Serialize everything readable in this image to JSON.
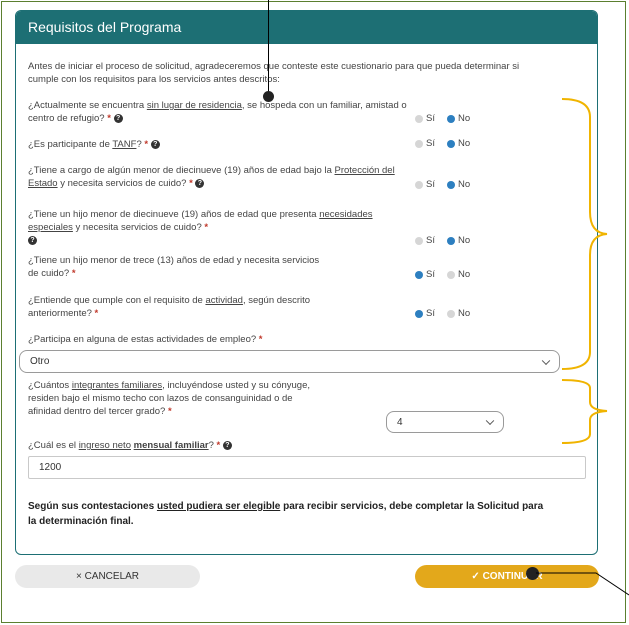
{
  "panel": {
    "title": "Requisitos del Programa"
  },
  "intro": "Antes de iniciar el proceso de solicitud, agradeceremos que conteste este cuestionario para que pueda determinar si cumple con los requisitos para los servicios antes descritos:",
  "radio_labels": {
    "yes": "Sí",
    "no": "No"
  },
  "questions": [
    {
      "pre": "¿Actualmente se encuentra ",
      "link": "sin lugar de residencia",
      "post": ", se hospeda con un familiar, amistad o centro de refugio?",
      "answer": "No"
    },
    {
      "pre": "¿Es participante de ",
      "link": "TANF",
      "post": "?",
      "answer": "No"
    },
    {
      "pre": "¿Tiene a cargo de algún menor de diecinueve (19) años de edad bajo la ",
      "link": "Protección del Estado",
      "post": " y necesita servicios de cuido?",
      "answer": "No"
    },
    {
      "pre": "¿Tiene un hijo menor de diecinueve (19) años de edad que presenta ",
      "link": "necesidades especiales",
      "post": " y necesita servicios de cuido?",
      "answer": "No"
    },
    {
      "pre": "¿Tiene un hijo menor de trece (13) años de edad y necesita servicios de cuido?",
      "link": "",
      "post": "",
      "answer": "Sí"
    },
    {
      "pre": "¿Entiende que cumple con el requisito de ",
      "link": "actividad",
      "post": ", según descrito anteriormente?",
      "answer": "Sí"
    }
  ],
  "employment": {
    "label": "¿Participa en alguna de estas actividades de empleo?",
    "value": "Otro"
  },
  "household": {
    "pre": "¿Cuántos ",
    "link": "integrantes familiares",
    "post": ", incluyéndose usted y su cónyuge, residen bajo el mismo techo con lazos de consanguinidad o de afinidad dentro del tercer grado?",
    "value": "4"
  },
  "income": {
    "pre": "¿Cuál es el ",
    "link1": "ingreso neto",
    "link2": "mensual familiar",
    "post": "?",
    "value": "1200"
  },
  "result": {
    "pre": "Según sus contestaciones ",
    "link": "usted pudiera ser elegible",
    "post": " para recibir servicios, debe completar la Solicitud para la determinación final."
  },
  "buttons": {
    "cancel": "× CANCELAR",
    "continue": "✓ CONTINUAR"
  },
  "colors": {
    "header": "#1d6f74",
    "accent": "#e3a81b",
    "selected_radio": "#2d7fc0",
    "required": "#c0392b",
    "annotation_brace": "#f0b400"
  }
}
